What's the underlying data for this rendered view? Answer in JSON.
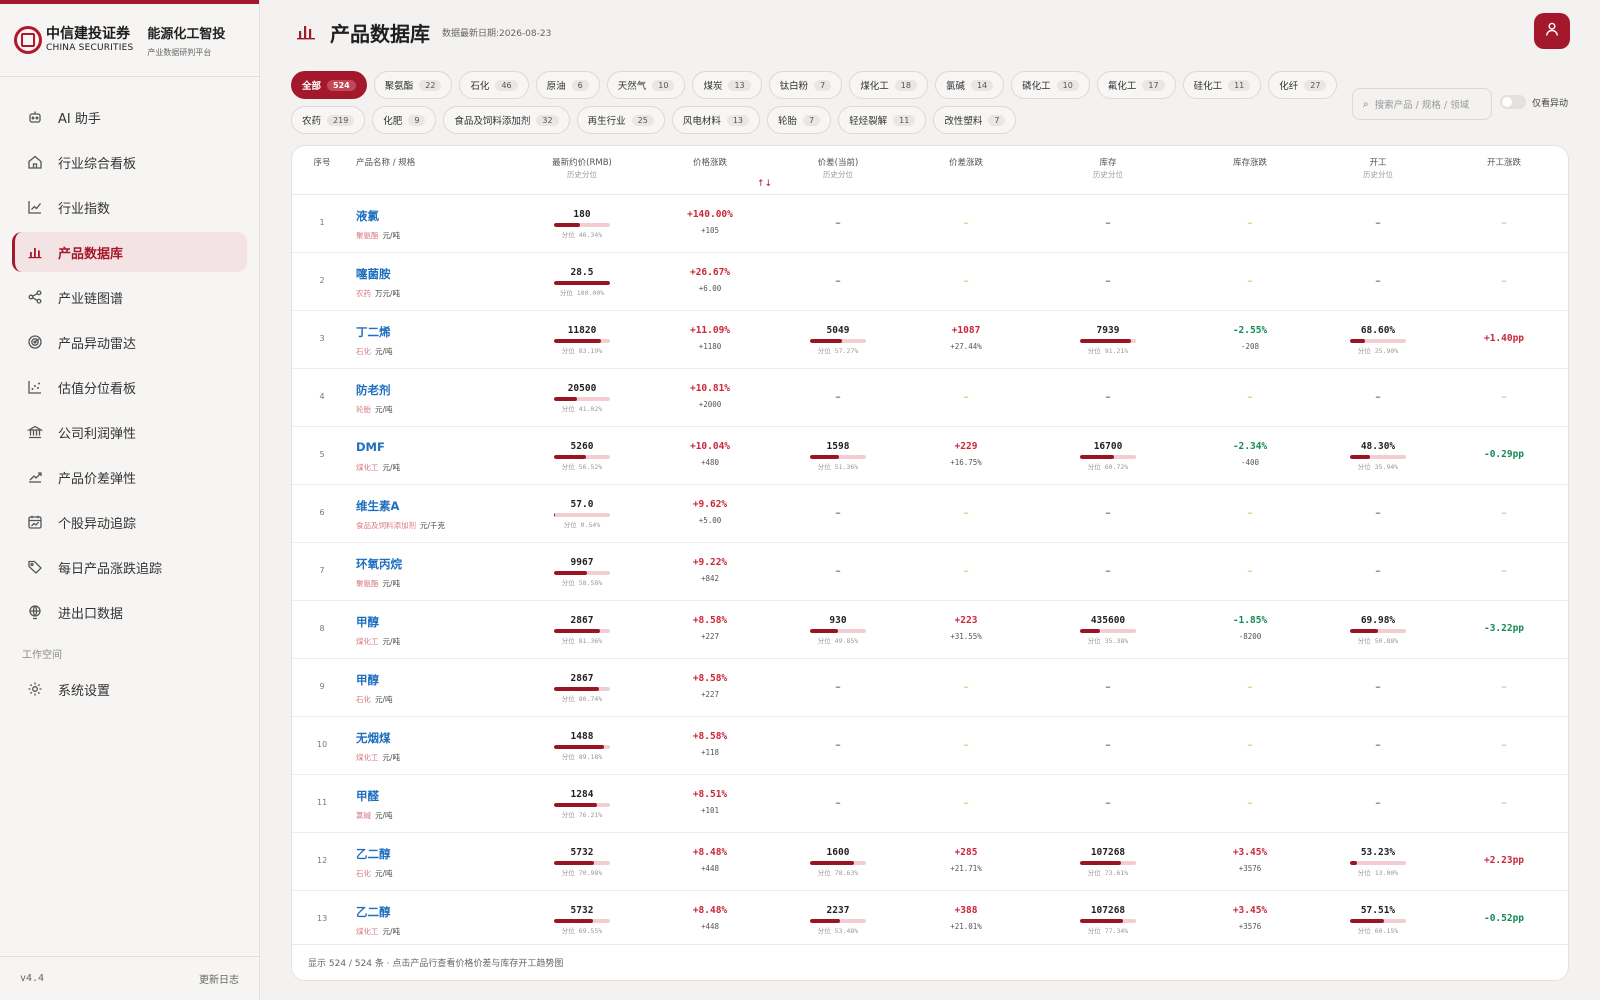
{
  "brand": {
    "logo_cn": "中信建投证券",
    "logo_en": "CHINA SECURITIES",
    "title": "能源化工智投",
    "subtitle": "产业数据研判平台"
  },
  "nav": [
    {
      "label": "AI 助手",
      "icon": "robot-icon"
    },
    {
      "label": "行业综合看板",
      "icon": "home-icon"
    },
    {
      "label": "行业指数",
      "icon": "line-chart-icon"
    },
    {
      "label": "产品数据库",
      "icon": "bar-chart-icon",
      "active": true
    },
    {
      "label": "产业链图谱",
      "icon": "share-icon"
    },
    {
      "label": "产品异动雷达",
      "icon": "radar-icon"
    },
    {
      "label": "估值分位看板",
      "icon": "scatter-icon"
    },
    {
      "label": "公司利润弹性",
      "icon": "bank-icon"
    },
    {
      "label": "产品价差弹性",
      "icon": "trend-icon"
    },
    {
      "label": "个股异动追踪",
      "icon": "calendar-chart-icon"
    },
    {
      "label": "每日产品涨跌追踪",
      "icon": "tag-icon"
    },
    {
      "label": "进出口数据",
      "icon": "globe-icon"
    }
  ],
  "workspace": {
    "label": "工作空间",
    "settings": "系统设置"
  },
  "footer": {
    "version": "v4.4",
    "changelog": "更新日志"
  },
  "header": {
    "title": "产品数据库",
    "date": "数据最新日期:2026-08-23"
  },
  "search": {
    "placeholder": "搜索产品 / 规格 / 领域"
  },
  "toggle": {
    "label": "仅看异动"
  },
  "chips_row1": [
    {
      "label": "全部",
      "count": "524",
      "active": true
    },
    {
      "label": "聚氨酯",
      "count": "22"
    },
    {
      "label": "石化",
      "count": "46"
    },
    {
      "label": "原油",
      "count": "6"
    },
    {
      "label": "天然气",
      "count": "10"
    },
    {
      "label": "煤炭",
      "count": "13"
    },
    {
      "label": "钛白粉",
      "count": "7"
    },
    {
      "label": "煤化工",
      "count": "18"
    },
    {
      "label": "氯碱",
      "count": "14"
    },
    {
      "label": "磷化工",
      "count": "10"
    },
    {
      "label": "氟化工",
      "count": "17"
    },
    {
      "label": "硅化工",
      "count": "11"
    },
    {
      "label": "化纤",
      "count": "27"
    }
  ],
  "chips_row2": [
    {
      "label": "农药",
      "count": "219"
    },
    {
      "label": "化肥",
      "count": "9"
    },
    {
      "label": "食品及饲料添加剂",
      "count": "32"
    },
    {
      "label": "再生行业",
      "count": "25"
    },
    {
      "label": "风电材料",
      "count": "13"
    },
    {
      "label": "轮胎",
      "count": "7"
    },
    {
      "label": "轻烃裂解",
      "count": "11"
    },
    {
      "label": "改性塑料",
      "count": "7"
    }
  ],
  "table": {
    "headers": {
      "idx": "序号",
      "name": "产品名称 / 规格",
      "price": "最新约价(RMB)",
      "price_sub": "历史分位",
      "price_chg": "价格涨跌",
      "spread": "价差(当前)",
      "spread_sub": "历史分位",
      "spread_chg": "价差涨跌",
      "stock": "库存",
      "stock_sub": "历史分位",
      "stock_chg": "库存涨跌",
      "op": "开工",
      "op_sub": "历史分位",
      "op_chg": "开工涨跌",
      "sort": "↑↓"
    },
    "dash": "–",
    "rows": [
      {
        "idx": "1",
        "name": "液氯",
        "cat": "聚氨酯",
        "unit": "元/吨",
        "price": "180",
        "price_pct": 46.34,
        "price_pct_text": "分位 46.34%",
        "chg": "+140.00%",
        "chg_abs": "+105"
      },
      {
        "idx": "2",
        "name": "噻菌胺",
        "cat": "农药",
        "unit": "万元/吨",
        "price": "28.5",
        "price_pct": 100.0,
        "price_pct_text": "分位 100.00%",
        "chg": "+26.67%",
        "chg_abs": "+6.00"
      },
      {
        "idx": "3",
        "name": "丁二烯",
        "cat": "石化",
        "unit": "元/吨",
        "price": "11820",
        "price_pct": 83.19,
        "price_pct_text": "分位 83.19%",
        "chg": "+11.09%",
        "chg_abs": "+1180",
        "spread": "5049",
        "spread_pct": 57.27,
        "spread_pct_text": "分位 57.27%",
        "spread_chg": "+1087",
        "spread_chg_pct": "+27.44%",
        "stock": "7939",
        "stock_pct": 91.21,
        "stock_pct_text": "分位 91.21%",
        "stock_chg": "-2.55%",
        "stock_chg_abs": "-208",
        "op": "68.60%",
        "op_pct": 25.9,
        "op_pct_text": "分位 25.90%",
        "op_chg": "+1.40pp"
      },
      {
        "idx": "4",
        "name": "防老剂",
        "cat": "轮胎",
        "unit": "元/吨",
        "price": "20500",
        "price_pct": 41.02,
        "price_pct_text": "分位 41.02%",
        "chg": "+10.81%",
        "chg_abs": "+2000"
      },
      {
        "idx": "5",
        "name": "DMF",
        "cat": "煤化工",
        "unit": "元/吨",
        "price": "5260",
        "price_pct": 56.52,
        "price_pct_text": "分位 56.52%",
        "chg": "+10.04%",
        "chg_abs": "+480",
        "spread": "1598",
        "spread_pct": 51.36,
        "spread_pct_text": "分位 51.36%",
        "spread_chg": "+229",
        "spread_chg_pct": "+16.75%",
        "stock": "16700",
        "stock_pct": 60.72,
        "stock_pct_text": "分位 60.72%",
        "stock_chg": "-2.34%",
        "stock_chg_abs": "-400",
        "op": "48.30%",
        "op_pct": 35.94,
        "op_pct_text": "分位 35.94%",
        "op_chg": "-0.29pp"
      },
      {
        "idx": "6",
        "name": "维生素A",
        "cat": "食品及饲料添加剂",
        "unit": "元/千克",
        "price": "57.0",
        "price_pct": 0.54,
        "price_pct_text": "分位 0.54%",
        "chg": "+9.62%",
        "chg_abs": "+5.00"
      },
      {
        "idx": "7",
        "name": "环氧丙烷",
        "cat": "聚氨酯",
        "unit": "元/吨",
        "price": "9967",
        "price_pct": 58.58,
        "price_pct_text": "分位 58.58%",
        "chg": "+9.22%",
        "chg_abs": "+842"
      },
      {
        "idx": "8",
        "name": "甲醇",
        "cat": "煤化工",
        "unit": "元/吨",
        "price": "2867",
        "price_pct": 81.36,
        "price_pct_text": "分位 81.36%",
        "chg": "+8.58%",
        "chg_abs": "+227",
        "spread": "930",
        "spread_pct": 49.85,
        "spread_pct_text": "分位 49.85%",
        "spread_chg": "+223",
        "spread_chg_pct": "+31.55%",
        "stock": "435600",
        "stock_pct": 35.38,
        "stock_pct_text": "分位 35.38%",
        "stock_chg": "-1.85%",
        "stock_chg_abs": "-8200",
        "op": "69.98%",
        "op_pct": 50.88,
        "op_pct_text": "分位 50.88%",
        "op_chg": "-3.22pp"
      },
      {
        "idx": "9",
        "name": "甲醇",
        "cat": "石化",
        "unit": "元/吨",
        "price": "2867",
        "price_pct": 80.74,
        "price_pct_text": "分位 80.74%",
        "chg": "+8.58%",
        "chg_abs": "+227"
      },
      {
        "idx": "10",
        "name": "无烟煤",
        "cat": "煤化工",
        "unit": "元/吨",
        "price": "1488",
        "price_pct": 89.18,
        "price_pct_text": "分位 89.18%",
        "chg": "+8.58%",
        "chg_abs": "+118"
      },
      {
        "idx": "11",
        "name": "甲醛",
        "cat": "氯碱",
        "unit": "元/吨",
        "price": "1284",
        "price_pct": 76.21,
        "price_pct_text": "分位 76.21%",
        "chg": "+8.51%",
        "chg_abs": "+101"
      },
      {
        "idx": "12",
        "name": "乙二醇",
        "cat": "石化",
        "unit": "元/吨",
        "price": "5732",
        "price_pct": 70.98,
        "price_pct_text": "分位 70.98%",
        "chg": "+8.48%",
        "chg_abs": "+448",
        "spread": "1600",
        "spread_pct": 78.63,
        "spread_pct_text": "分位 78.63%",
        "spread_chg": "+285",
        "spread_chg_pct": "+21.71%",
        "stock": "107268",
        "stock_pct": 73.61,
        "stock_pct_text": "分位 73.61%",
        "stock_chg": "+3.45%",
        "stock_chg_abs": "+3576",
        "op": "53.23%",
        "op_pct": 13.0,
        "op_pct_text": "分位 13.00%",
        "op_chg": "+2.23pp"
      },
      {
        "idx": "13",
        "name": "乙二醇",
        "cat": "煤化工",
        "unit": "元/吨",
        "price": "5732",
        "price_pct": 69.55,
        "price_pct_text": "分位 69.55%",
        "chg": "+8.48%",
        "chg_abs": "+448",
        "spread": "2237",
        "spread_pct": 53.48,
        "spread_pct_text": "分位 53.48%",
        "spread_chg": "+388",
        "spread_chg_pct": "+21.01%",
        "stock": "107268",
        "stock_pct": 77.34,
        "stock_pct_text": "分位 77.34%",
        "stock_chg": "+3.45%",
        "stock_chg_abs": "+3576",
        "op": "57.51%",
        "op_pct": 60.15,
        "op_pct_text": "分位 60.15%",
        "op_chg": "-0.52pp"
      }
    ],
    "footer_text": "显示 524 / 524 条 · 点击产品行查看价格价差与库存开工趋势图"
  },
  "colors": {
    "accent": "#a3192b",
    "up": "#c8283a",
    "down": "#148a57",
    "link": "#1f6fbf",
    "dash_yellow": "#d9a33e"
  }
}
